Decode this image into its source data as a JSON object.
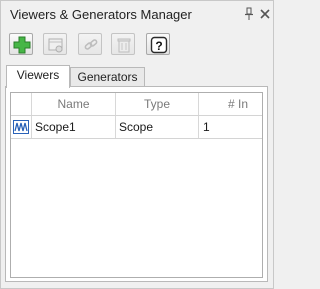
{
  "window": {
    "title": "Viewers & Generators Manager"
  },
  "toolbar": {
    "buttons": [
      {
        "name": "add-button",
        "icon": "plus-icon",
        "enabled": true
      },
      {
        "name": "select-signals-button",
        "icon": "select-signals-icon",
        "enabled": false
      },
      {
        "name": "connect-button",
        "icon": "link-icon",
        "enabled": false
      },
      {
        "name": "delete-button",
        "icon": "trash-icon",
        "enabled": false
      },
      {
        "name": "help-button",
        "icon": "help-icon",
        "enabled": true
      }
    ]
  },
  "tabs": [
    {
      "label": "Viewers",
      "active": true
    },
    {
      "label": "Generators",
      "active": false
    }
  ],
  "table": {
    "columns": [
      "",
      "Name",
      "Type",
      "# In"
    ],
    "rows": [
      {
        "icon": "scope-icon",
        "name": "Scope1",
        "type": "Scope",
        "inputs": "1"
      }
    ]
  },
  "colors": {
    "accent_green": "#3aa93a",
    "scope_icon_blue": "#2a62b8"
  }
}
